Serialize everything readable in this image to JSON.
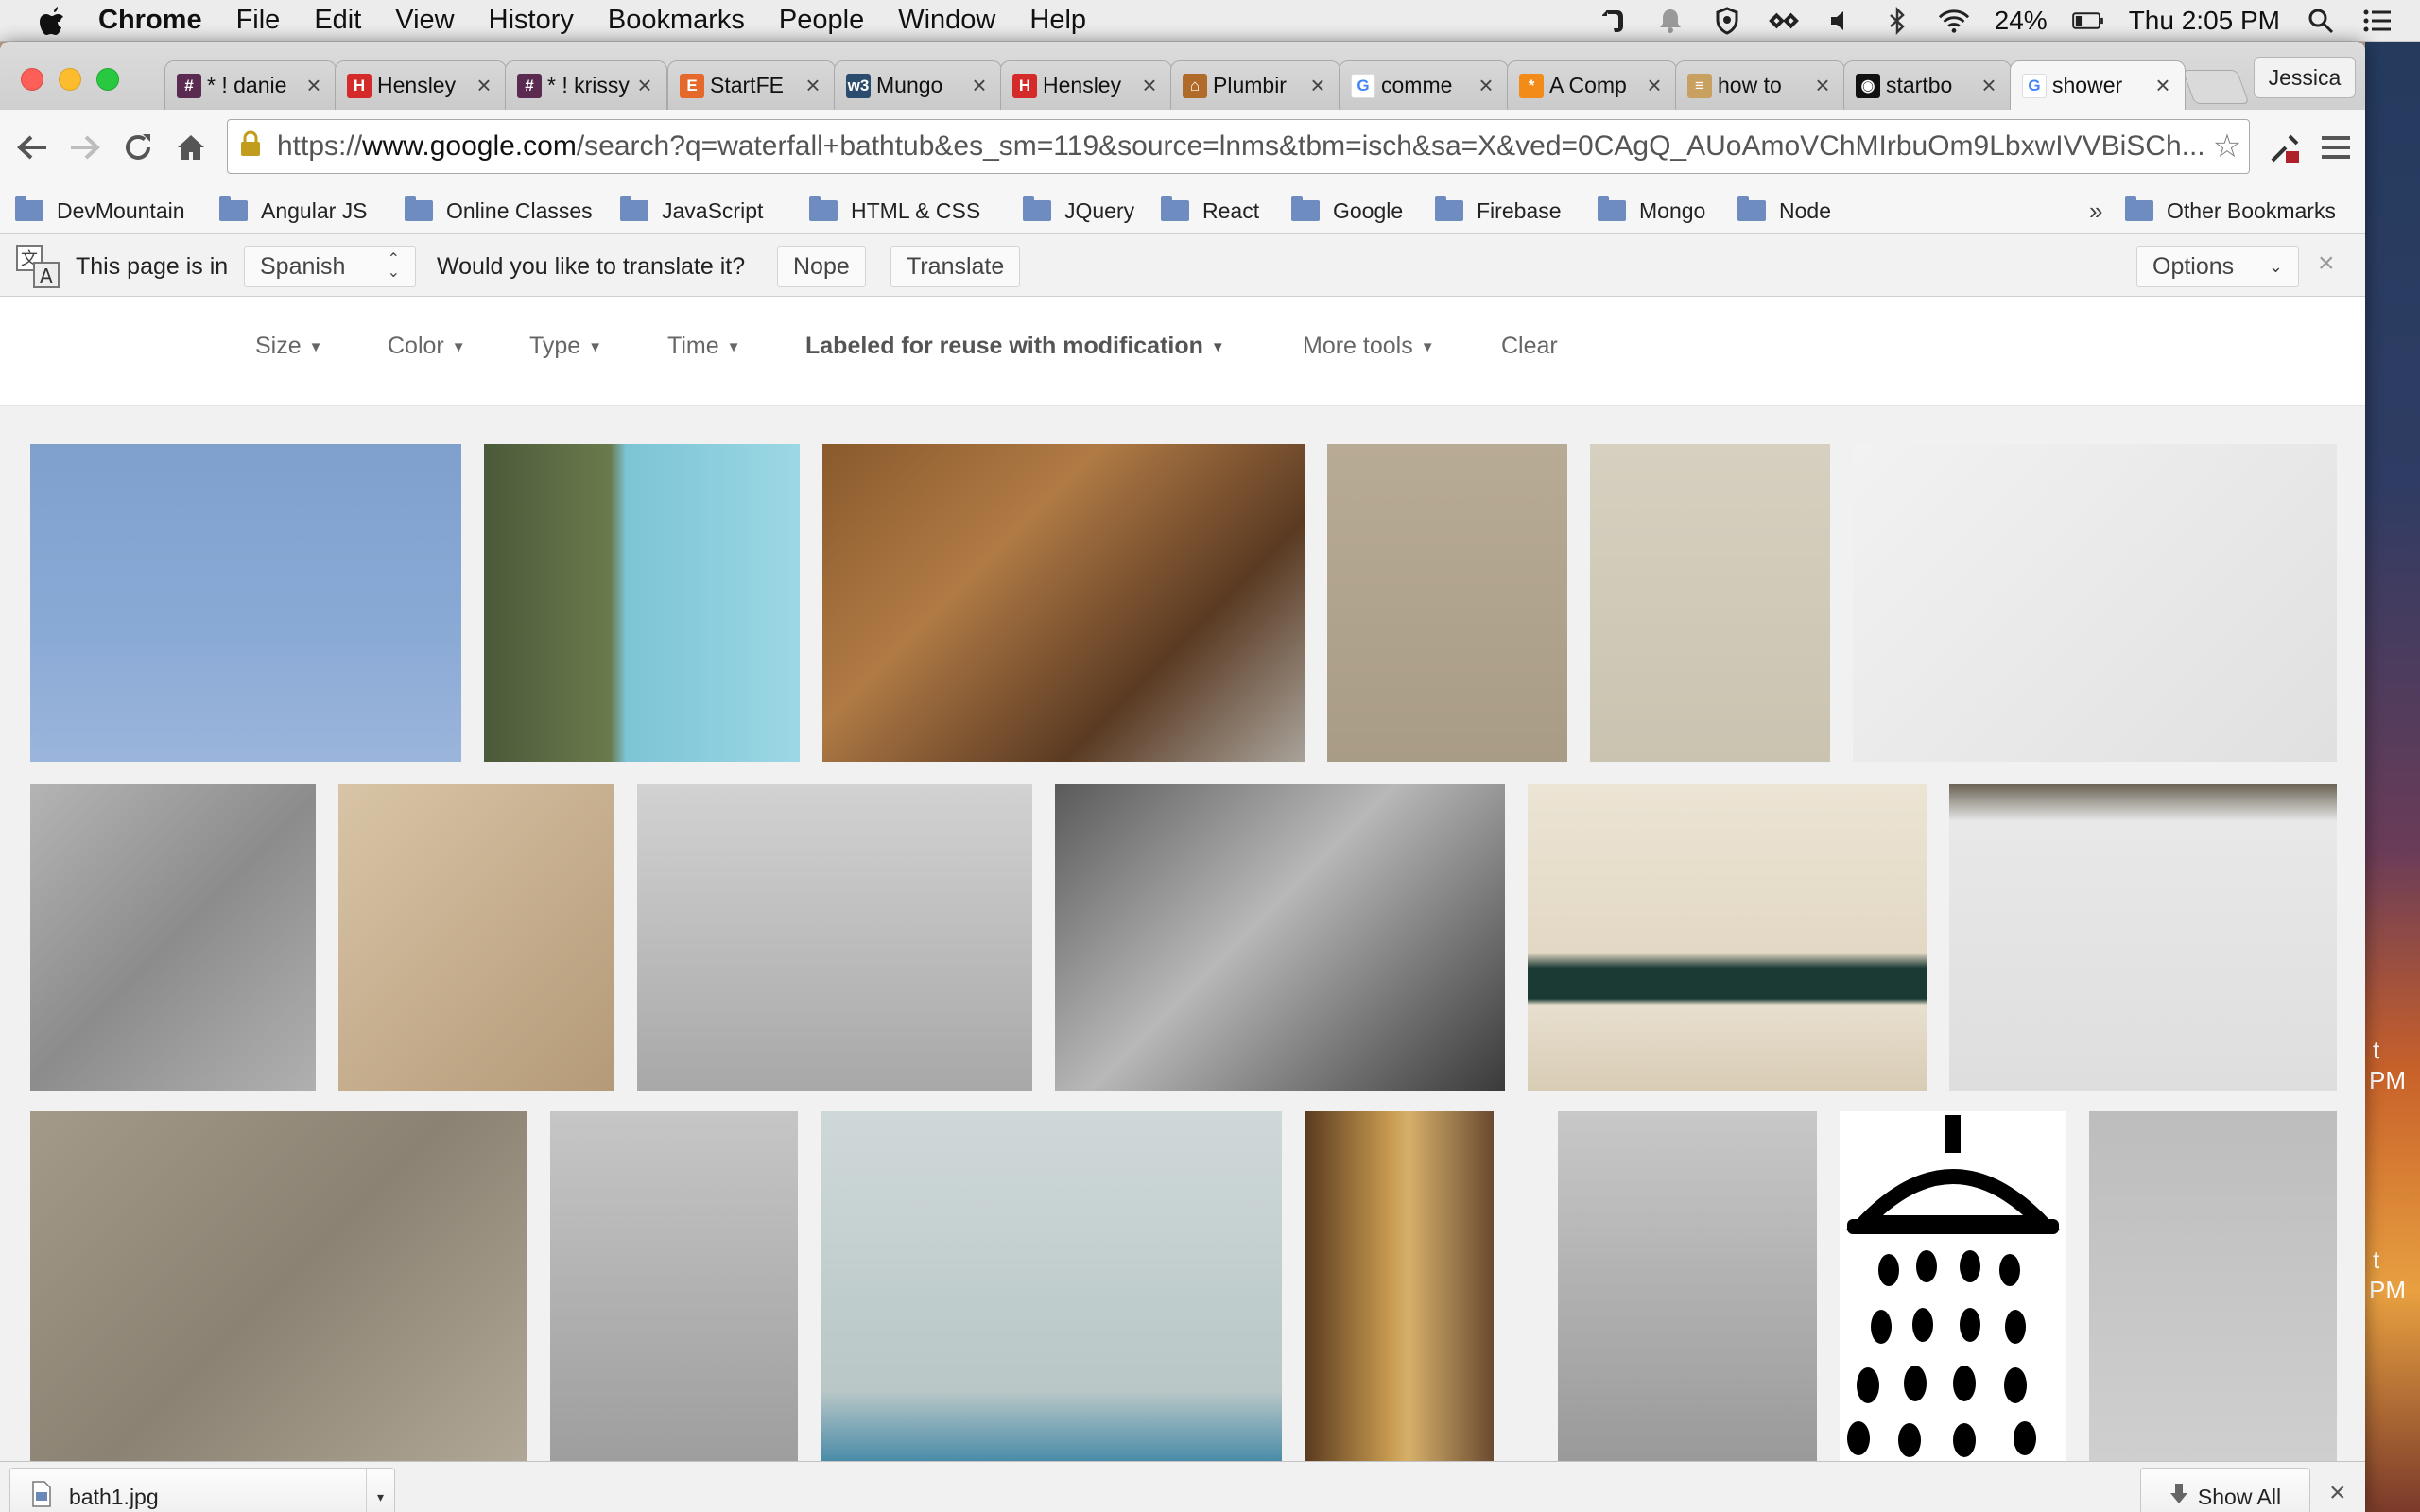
{
  "menubar": {
    "apple_icon": "apple-logo-icon",
    "app_name": "Chrome",
    "menus": [
      "File",
      "Edit",
      "View",
      "History",
      "Bookmarks",
      "People",
      "Window",
      "Help"
    ],
    "battery": "24%",
    "clock": "Thu 2:05 PM"
  },
  "tabs": [
    {
      "title": "* ! danie",
      "favicon": "#",
      "color": "#5b2a50"
    },
    {
      "title": "Hensley",
      "favicon": "H",
      "color": "#d42a2a"
    },
    {
      "title": "* ! krissy",
      "favicon": "#",
      "color": "#5b2a50"
    },
    {
      "title": "StartFE",
      "favicon": "E",
      "color": "#e5692b"
    },
    {
      "title": "Mungo",
      "favicon": "w3",
      "color": "#2a4c6e"
    },
    {
      "title": "Hensley",
      "favicon": "H",
      "color": "#d42a2a"
    },
    {
      "title": "Plumbir",
      "favicon": "⌂",
      "color": "#b06b2a"
    },
    {
      "title": "comme",
      "favicon": "G",
      "color": "#4285f4"
    },
    {
      "title": "A Comp",
      "favicon": "*",
      "color": "#f28b17"
    },
    {
      "title": "how to",
      "favicon": "≡",
      "color": "#c8a060"
    },
    {
      "title": "startbo",
      "favicon": "◉",
      "color": "#111111"
    },
    {
      "title": "shower",
      "favicon": "G",
      "color": "#4285f4"
    }
  ],
  "profile_name": "Jessica",
  "omnibox": {
    "scheme": "https://",
    "host": "www.google.com",
    "path": "/search?q=waterfall+bathtub&es_sm=119&source=lnms&tbm=isch&sa=X&ved=0CAgQ_AUoAmoVChMIrbuOm9LbxwIVVBiSCh..."
  },
  "bookmarks": [
    "DevMountain",
    "Angular JS",
    "Online Classes",
    "JavaScript",
    "HTML & CSS",
    "JQuery",
    "React",
    "Google",
    "Firebase",
    "Mongo",
    "Node"
  ],
  "bookmarks_overflow": "»",
  "other_bookmarks": "Other Bookmarks",
  "translate": {
    "prefix": "This page is in",
    "language": "Spanish",
    "question": "Would you like to translate it?",
    "nope": "Nope",
    "translate": "Translate",
    "options": "Options",
    "close": "×"
  },
  "filters": [
    "Size",
    "Color",
    "Type",
    "Time",
    "Labeled for reuse with modification",
    "More tools",
    "Clear"
  ],
  "download": {
    "file_name": "bath1.jpg",
    "show_all": "Show All",
    "close": "×"
  },
  "desktop_edge_text": [
    "t",
    "PM",
    "t",
    "PM"
  ],
  "images": [
    {
      "name": "image-shower-blue-sky",
      "bg": "linear-gradient(180deg,#7f9fcd 0%,#8aaad6 60%,#9bb5db 100%)"
    },
    {
      "name": "image-woman-outdoor-shower",
      "bg": "linear-gradient(90deg,#4a5a3a 0%,#6b7a4c 40%,#7cc4d6 45%,#9cd8e4 100%)"
    },
    {
      "name": "image-showerhead-closeup",
      "bg": "linear-gradient(135deg,#8a5a2c 0%,#b07a45 35%,#5a3a22 70%,#a9a39b 100%)"
    },
    {
      "name": "image-beige-tile-shower",
      "bg": "linear-gradient(180deg,#b8ab95 0%,#a99c86 100%)"
    },
    {
      "name": "image-circular-shower-frame",
      "bg": "linear-gradient(180deg,#d6d0c0 0%,#c9c3b0 100%)"
    },
    {
      "name": "image-handheld-shower-white",
      "bg": "linear-gradient(135deg,#f2f2f2 0%,#e0e0e0 100%)"
    },
    {
      "name": "image-shower-curtain",
      "bg": "linear-gradient(135deg,#b4b4b4 0%,#8c8c8c 50%,#b0b0b0 100%)"
    },
    {
      "name": "image-showerhead-spray",
      "bg": "linear-gradient(135deg,#d8c4a6 0%,#b49a78 100%)"
    },
    {
      "name": "image-mixer-with-hose",
      "bg": "linear-gradient(180deg,#d2d2d2 0%,#a8a8a8 100%)"
    },
    {
      "name": "image-showerhead-grayscale",
      "bg": "linear-gradient(135deg,#5a5a5a 0%,#b8b8b8 45%,#3a3a3a 100%)"
    },
    {
      "name": "image-shower-green-border",
      "bg": "linear-gradient(180deg,#ece4d4 0%,#e2d8c4 55%,#1b3a34 60%,#1b3a34 70%,#e8dfcf 72%,#d8ccb4 100%)"
    },
    {
      "name": "image-sony-shower-radio",
      "bg": "linear-gradient(180deg,#6b6354 0%,#e8e8e8 12%,#dedede 100%)"
    },
    {
      "name": "image-tiled-walk-in-shower",
      "bg": "linear-gradient(135deg,#a49a89 0%,#8c8273 50%,#b0a796 100%)"
    },
    {
      "name": "image-wall-mixer-hose",
      "bg": "linear-gradient(180deg,#c6c6c6 0%,#9e9e9e 100%)"
    },
    {
      "name": "image-accessible-shower-room",
      "bg": "linear-gradient(180deg,#cfd8d8 0%,#b9c7c7 80%,#4a8ca8 100%)"
    },
    {
      "name": "image-antique-shower-cabinet",
      "bg": "linear-gradient(90deg,#5a3a1f 0%,#c79a50 45%,#d6b06a 55%,#6a4a30 100%)"
    },
    {
      "name": "image-shower-rail-tiles",
      "bg": "linear-gradient(180deg,#c8c8c8 0%,#9a9a9a 100%)"
    },
    {
      "name": "image-shower-icon",
      "bg": "#ffffff"
    },
    {
      "name": "image-grey-tile-shower",
      "bg": "linear-gradient(180deg,#bdbdbd 0%,#cfcfcf 100%)"
    }
  ]
}
